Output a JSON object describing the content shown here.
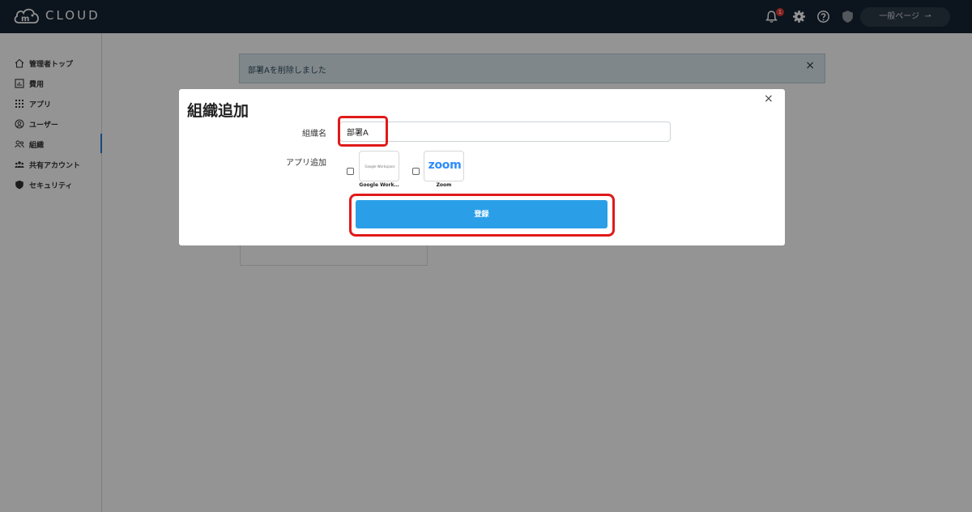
{
  "header": {
    "logo_text": "CLOUD",
    "notification_count": "1",
    "general_page_label": "一般ページ"
  },
  "sidebar": {
    "items": [
      {
        "label": "管理者トップ",
        "icon": "home-icon"
      },
      {
        "label": "費用",
        "icon": "chart-icon"
      },
      {
        "label": "アプリ",
        "icon": "grid-icon"
      },
      {
        "label": "ユーザー",
        "icon": "user-circle-icon"
      },
      {
        "label": "組織",
        "icon": "people-icon"
      },
      {
        "label": "共有アカウント",
        "icon": "group-icon"
      },
      {
        "label": "セキュリティ",
        "icon": "shield-icon"
      }
    ],
    "active": "組織"
  },
  "alert": {
    "message": "部署Aを削除しました",
    "close": "×"
  },
  "modal": {
    "title": "組織追加",
    "close": "×",
    "name_label": "組織名",
    "name_value": "部署A",
    "apps_label": "アプリ追加",
    "apps": [
      {
        "name": "Google Work…",
        "logo_text": "Google Workspace"
      },
      {
        "name": "Zoom",
        "logo_text": "zoom"
      }
    ],
    "submit_label": "登録",
    "highlight_color": "#e01a1a",
    "button_color": "#2a9fe8"
  }
}
